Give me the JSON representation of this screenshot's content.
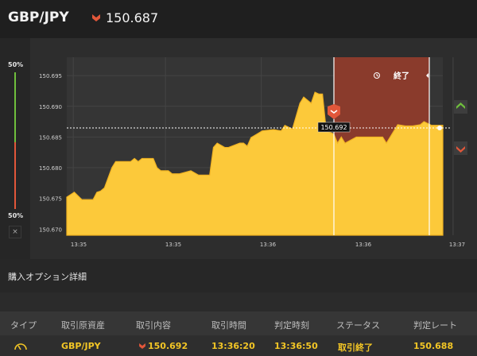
{
  "header": {
    "pair": "GBP/JPY",
    "price": "150.687",
    "direction_icon": "down-arrow-icon"
  },
  "chart": {
    "y_ticks": [
      "150.695",
      "150.690",
      "150.685",
      "150.680",
      "150.675",
      "150.670"
    ],
    "x_ticks": [
      "13:35",
      "13:35",
      "13:36",
      "13:36",
      "13:37"
    ],
    "current_price_label": "150.692",
    "end_label": "終了",
    "pct_top": "50%",
    "pct_bottom": "50%",
    "close_label": "×",
    "colors": {
      "area": "#fcc93a",
      "expired_zone": "#8a3b2c",
      "up": "#6fbf3c",
      "down": "#e2573a"
    }
  },
  "chart_data": {
    "type": "area",
    "x": [
      0.0,
      0.02,
      0.04,
      0.07,
      0.08,
      0.09,
      0.1,
      0.12,
      0.13,
      0.14,
      0.17,
      0.18,
      0.19,
      0.2,
      0.23,
      0.24,
      0.25,
      0.27,
      0.28,
      0.3,
      0.33,
      0.35,
      0.38,
      0.39,
      0.4,
      0.42,
      0.43,
      0.46,
      0.47,
      0.48,
      0.49,
      0.52,
      0.55,
      0.57,
      0.58,
      0.6,
      0.62,
      0.63,
      0.65,
      0.66,
      0.67,
      0.68,
      0.69,
      0.71,
      0.72,
      0.73,
      0.74,
      0.77,
      0.78,
      0.79,
      0.81,
      0.83,
      0.84,
      0.85,
      0.86,
      0.88,
      0.9,
      0.92,
      0.94,
      0.95,
      0.97,
      1.0
    ],
    "y": [
      150.6752,
      150.676,
      150.6748,
      150.6748,
      150.676,
      150.6762,
      150.6767,
      150.68,
      150.681,
      150.681,
      150.681,
      150.6815,
      150.681,
      150.6815,
      150.6815,
      150.68,
      150.6795,
      150.6795,
      150.679,
      150.679,
      150.6795,
      150.6788,
      150.6788,
      150.6833,
      150.684,
      150.6833,
      150.6833,
      150.684,
      150.684,
      150.6835,
      150.6849,
      150.686,
      150.6862,
      150.686,
      150.6869,
      150.6863,
      150.6905,
      150.6915,
      150.6905,
      150.6923,
      150.692,
      150.692,
      150.686,
      150.6855,
      150.684,
      150.685,
      150.684,
      150.685,
      150.685,
      150.685,
      150.685,
      150.685,
      150.685,
      150.684,
      150.685,
      150.687,
      150.6868,
      150.6868,
      150.687,
      150.6875,
      150.6869,
      150.6869
    ],
    "ylim": [
      150.669,
      150.698
    ],
    "xlabel": "",
    "ylabel": "",
    "grid": true
  },
  "section": {
    "title": "購入オプション詳細"
  },
  "table": {
    "headers": [
      "タイプ",
      "取引原資産",
      "取引内容",
      "取引時間",
      "判定時刻",
      "ステータス",
      "判定レート"
    ],
    "row": {
      "type_icon": "gauge-icon",
      "asset": "GBP/JPY",
      "content_icon": "down-arrow-icon",
      "content": "150.692",
      "trade_time": "13:36:20",
      "judge_time": "13:36:50",
      "status": "取引終了",
      "judge_rate": "150.688"
    }
  }
}
